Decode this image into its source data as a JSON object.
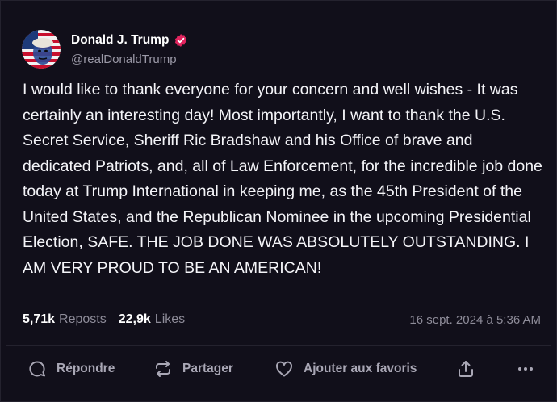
{
  "post": {
    "author_name": "Donald J. Trump",
    "author_handle": "@realDonaldTrump",
    "text": "I would like to thank everyone for your concern and well wishes - It was certainly an interesting day! Most importantly, I want to thank the U.S. Secret Service, Sheriff Ric Bradshaw and his Office of brave and dedicated Patriots, and, all of Law Enforcement, for the incredible job done today at Trump International in keeping me, as the 45th President of the United States, and the Republican Nominee in the upcoming Presidential Election, SAFE. THE JOB DONE WAS ABSOLUTELY OUTSTANDING. I AM VERY PROUD TO BE AN AMERICAN!",
    "reposts_count": "5,71k",
    "reposts_label": "Reposts",
    "likes_count": "22,9k",
    "likes_label": "Likes",
    "timestamp": "16 sept. 2024 à 5:36 AM"
  },
  "actions": {
    "reply_label": "Répondre",
    "share_label": "Partager",
    "favorite_label": "Ajouter aux favoris"
  },
  "icons": {
    "verified": "verified-badge-icon",
    "reply": "speech-bubble-icon",
    "share": "repost-arrows-icon",
    "favorite": "heart-icon",
    "upload": "upload-icon",
    "more": "ellipsis-icon"
  },
  "colors": {
    "background": "#110f1a",
    "verified_badge": "#e0245e",
    "muted_text": "#8e8c99"
  }
}
